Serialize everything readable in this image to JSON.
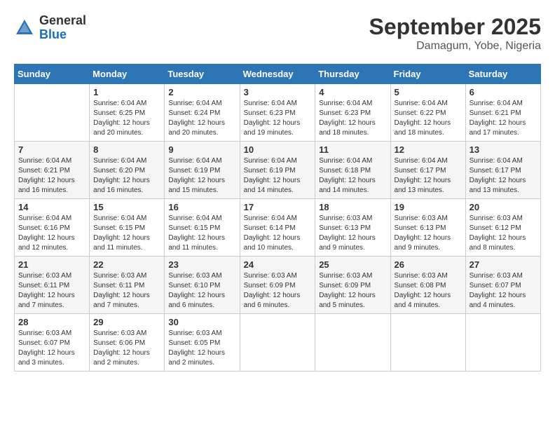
{
  "header": {
    "logo_general": "General",
    "logo_blue": "Blue",
    "month_year": "September 2025",
    "location": "Damagum, Yobe, Nigeria"
  },
  "days_of_week": [
    "Sunday",
    "Monday",
    "Tuesday",
    "Wednesday",
    "Thursday",
    "Friday",
    "Saturday"
  ],
  "weeks": [
    [
      {
        "day": "",
        "sunrise": "",
        "sunset": "",
        "daylight": ""
      },
      {
        "day": "1",
        "sunrise": "Sunrise: 6:04 AM",
        "sunset": "Sunset: 6:25 PM",
        "daylight": "Daylight: 12 hours and 20 minutes."
      },
      {
        "day": "2",
        "sunrise": "Sunrise: 6:04 AM",
        "sunset": "Sunset: 6:24 PM",
        "daylight": "Daylight: 12 hours and 20 minutes."
      },
      {
        "day": "3",
        "sunrise": "Sunrise: 6:04 AM",
        "sunset": "Sunset: 6:23 PM",
        "daylight": "Daylight: 12 hours and 19 minutes."
      },
      {
        "day": "4",
        "sunrise": "Sunrise: 6:04 AM",
        "sunset": "Sunset: 6:23 PM",
        "daylight": "Daylight: 12 hours and 18 minutes."
      },
      {
        "day": "5",
        "sunrise": "Sunrise: 6:04 AM",
        "sunset": "Sunset: 6:22 PM",
        "daylight": "Daylight: 12 hours and 18 minutes."
      },
      {
        "day": "6",
        "sunrise": "Sunrise: 6:04 AM",
        "sunset": "Sunset: 6:21 PM",
        "daylight": "Daylight: 12 hours and 17 minutes."
      }
    ],
    [
      {
        "day": "7",
        "sunrise": "Sunrise: 6:04 AM",
        "sunset": "Sunset: 6:21 PM",
        "daylight": "Daylight: 12 hours and 16 minutes."
      },
      {
        "day": "8",
        "sunrise": "Sunrise: 6:04 AM",
        "sunset": "Sunset: 6:20 PM",
        "daylight": "Daylight: 12 hours and 16 minutes."
      },
      {
        "day": "9",
        "sunrise": "Sunrise: 6:04 AM",
        "sunset": "Sunset: 6:19 PM",
        "daylight": "Daylight: 12 hours and 15 minutes."
      },
      {
        "day": "10",
        "sunrise": "Sunrise: 6:04 AM",
        "sunset": "Sunset: 6:19 PM",
        "daylight": "Daylight: 12 hours and 14 minutes."
      },
      {
        "day": "11",
        "sunrise": "Sunrise: 6:04 AM",
        "sunset": "Sunset: 6:18 PM",
        "daylight": "Daylight: 12 hours and 14 minutes."
      },
      {
        "day": "12",
        "sunrise": "Sunrise: 6:04 AM",
        "sunset": "Sunset: 6:17 PM",
        "daylight": "Daylight: 12 hours and 13 minutes."
      },
      {
        "day": "13",
        "sunrise": "Sunrise: 6:04 AM",
        "sunset": "Sunset: 6:17 PM",
        "daylight": "Daylight: 12 hours and 13 minutes."
      }
    ],
    [
      {
        "day": "14",
        "sunrise": "Sunrise: 6:04 AM",
        "sunset": "Sunset: 6:16 PM",
        "daylight": "Daylight: 12 hours and 12 minutes."
      },
      {
        "day": "15",
        "sunrise": "Sunrise: 6:04 AM",
        "sunset": "Sunset: 6:15 PM",
        "daylight": "Daylight: 12 hours and 11 minutes."
      },
      {
        "day": "16",
        "sunrise": "Sunrise: 6:04 AM",
        "sunset": "Sunset: 6:15 PM",
        "daylight": "Daylight: 12 hours and 11 minutes."
      },
      {
        "day": "17",
        "sunrise": "Sunrise: 6:04 AM",
        "sunset": "Sunset: 6:14 PM",
        "daylight": "Daylight: 12 hours and 10 minutes."
      },
      {
        "day": "18",
        "sunrise": "Sunrise: 6:03 AM",
        "sunset": "Sunset: 6:13 PM",
        "daylight": "Daylight: 12 hours and 9 minutes."
      },
      {
        "day": "19",
        "sunrise": "Sunrise: 6:03 AM",
        "sunset": "Sunset: 6:13 PM",
        "daylight": "Daylight: 12 hours and 9 minutes."
      },
      {
        "day": "20",
        "sunrise": "Sunrise: 6:03 AM",
        "sunset": "Sunset: 6:12 PM",
        "daylight": "Daylight: 12 hours and 8 minutes."
      }
    ],
    [
      {
        "day": "21",
        "sunrise": "Sunrise: 6:03 AM",
        "sunset": "Sunset: 6:11 PM",
        "daylight": "Daylight: 12 hours and 7 minutes."
      },
      {
        "day": "22",
        "sunrise": "Sunrise: 6:03 AM",
        "sunset": "Sunset: 6:11 PM",
        "daylight": "Daylight: 12 hours and 7 minutes."
      },
      {
        "day": "23",
        "sunrise": "Sunrise: 6:03 AM",
        "sunset": "Sunset: 6:10 PM",
        "daylight": "Daylight: 12 hours and 6 minutes."
      },
      {
        "day": "24",
        "sunrise": "Sunrise: 6:03 AM",
        "sunset": "Sunset: 6:09 PM",
        "daylight": "Daylight: 12 hours and 6 minutes."
      },
      {
        "day": "25",
        "sunrise": "Sunrise: 6:03 AM",
        "sunset": "Sunset: 6:09 PM",
        "daylight": "Daylight: 12 hours and 5 minutes."
      },
      {
        "day": "26",
        "sunrise": "Sunrise: 6:03 AM",
        "sunset": "Sunset: 6:08 PM",
        "daylight": "Daylight: 12 hours and 4 minutes."
      },
      {
        "day": "27",
        "sunrise": "Sunrise: 6:03 AM",
        "sunset": "Sunset: 6:07 PM",
        "daylight": "Daylight: 12 hours and 4 minutes."
      }
    ],
    [
      {
        "day": "28",
        "sunrise": "Sunrise: 6:03 AM",
        "sunset": "Sunset: 6:07 PM",
        "daylight": "Daylight: 12 hours and 3 minutes."
      },
      {
        "day": "29",
        "sunrise": "Sunrise: 6:03 AM",
        "sunset": "Sunset: 6:06 PM",
        "daylight": "Daylight: 12 hours and 2 minutes."
      },
      {
        "day": "30",
        "sunrise": "Sunrise: 6:03 AM",
        "sunset": "Sunset: 6:05 PM",
        "daylight": "Daylight: 12 hours and 2 minutes."
      },
      {
        "day": "",
        "sunrise": "",
        "sunset": "",
        "daylight": ""
      },
      {
        "day": "",
        "sunrise": "",
        "sunset": "",
        "daylight": ""
      },
      {
        "day": "",
        "sunrise": "",
        "sunset": "",
        "daylight": ""
      },
      {
        "day": "",
        "sunrise": "",
        "sunset": "",
        "daylight": ""
      }
    ]
  ]
}
